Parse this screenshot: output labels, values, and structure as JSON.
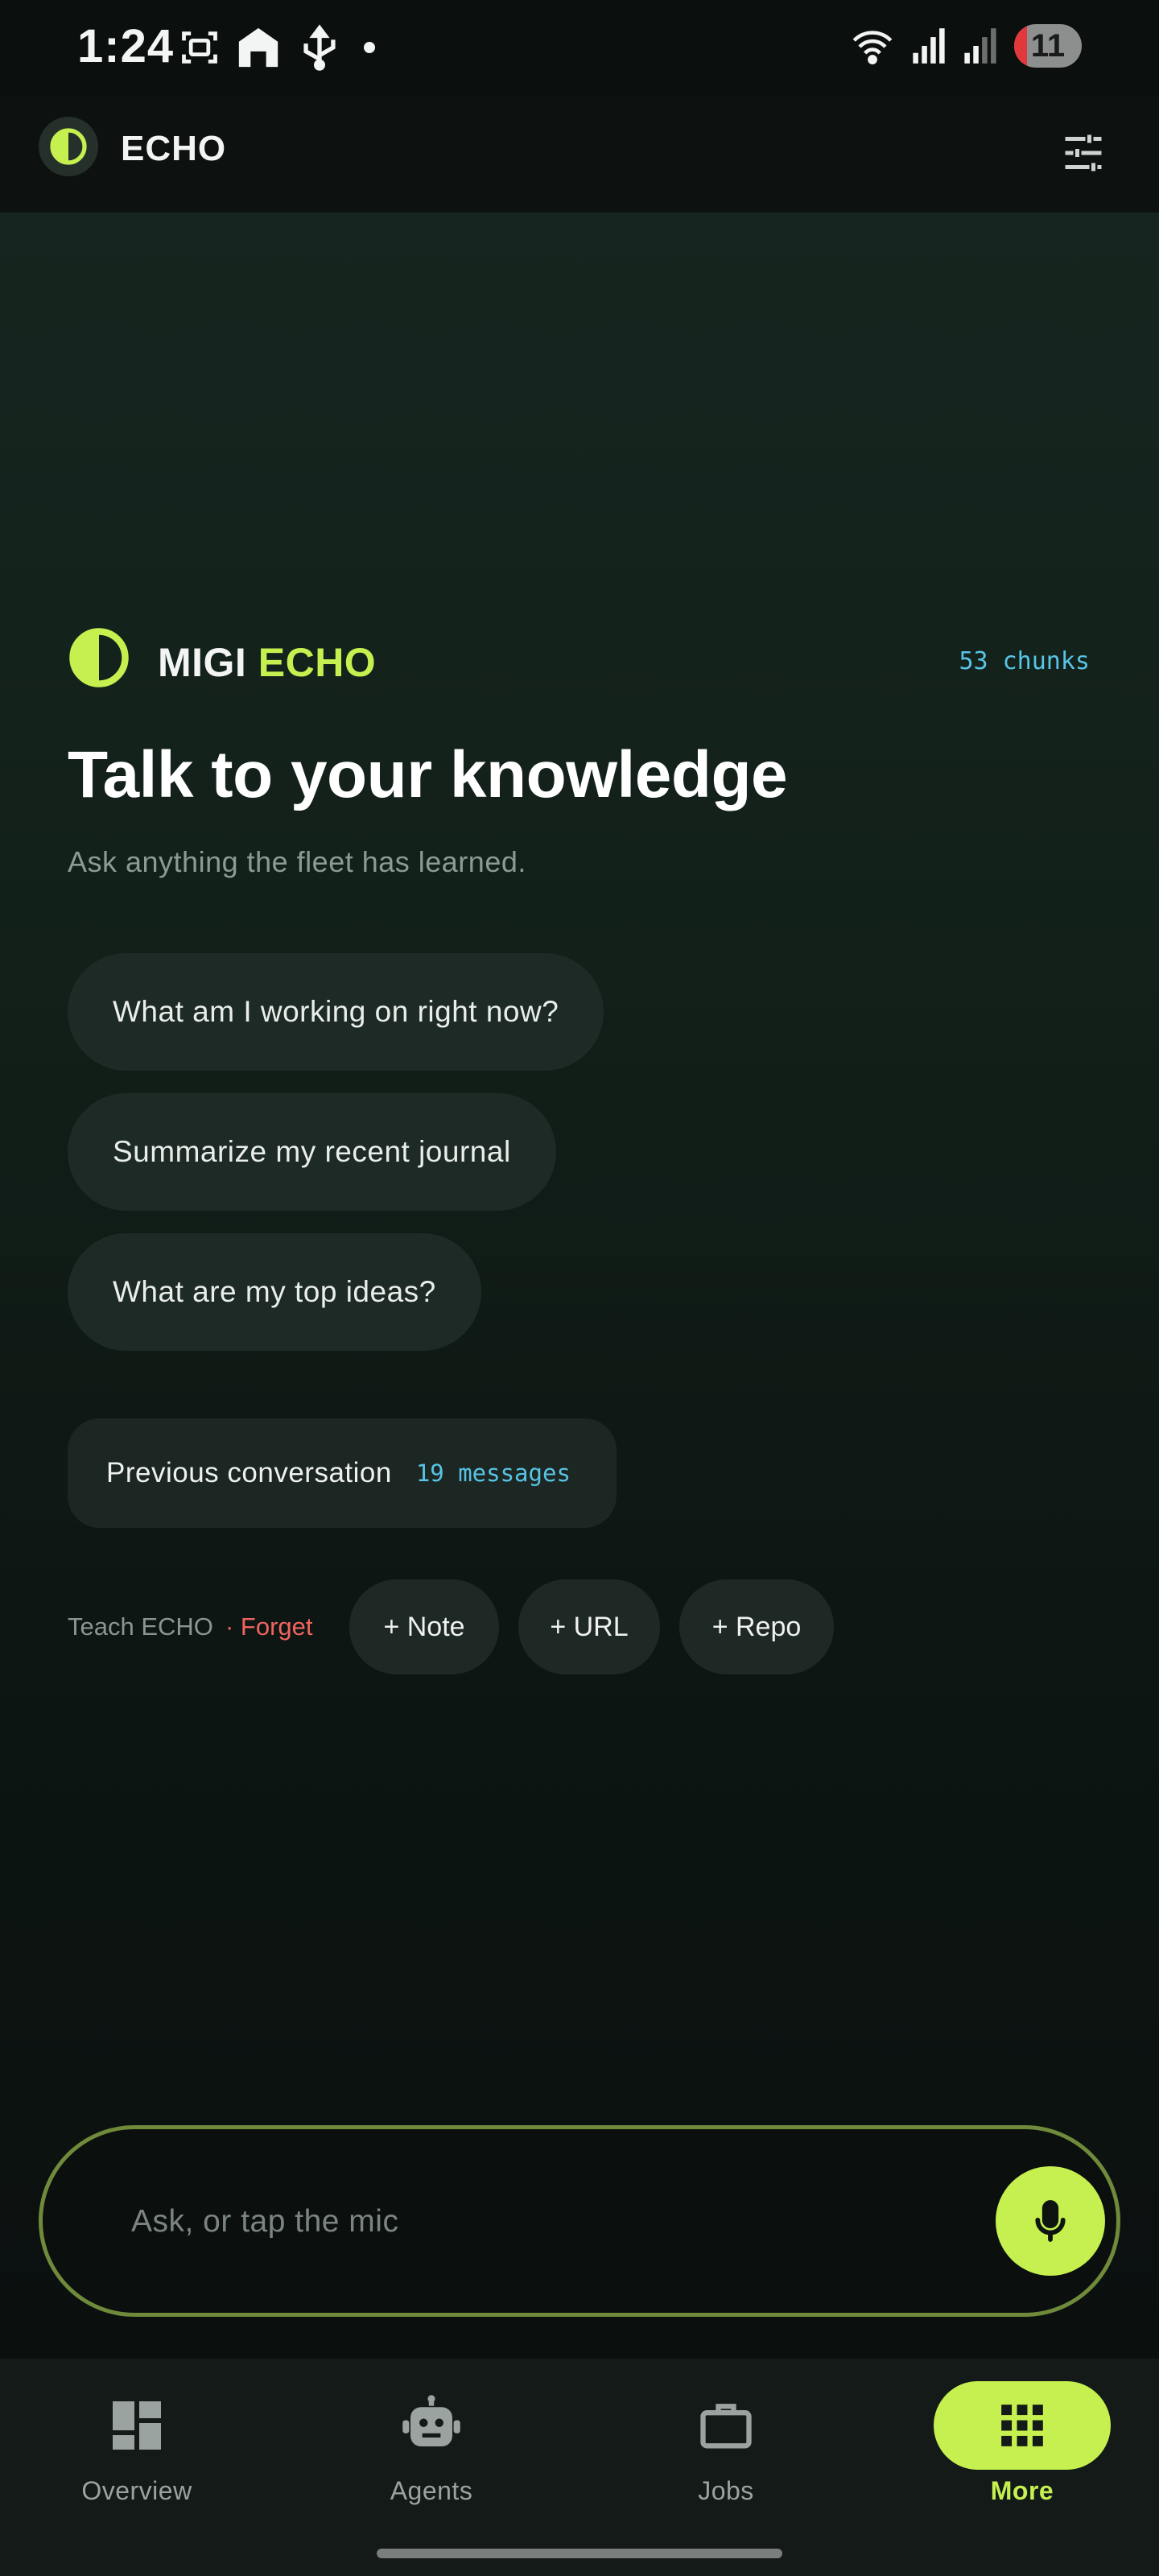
{
  "status_bar": {
    "time": "1:24",
    "battery": "11",
    "icons": [
      "screenshot-icon",
      "home-icon",
      "usb-icon",
      "dot-icon",
      "wifi-icon",
      "signal-icon",
      "signal-roaming-icon",
      "battery-icon"
    ]
  },
  "app_bar": {
    "title": "ECHO",
    "logo_icon": "half-circle-logo-icon",
    "settings_icon": "sliders-icon"
  },
  "hero": {
    "brand_prefix": "MIGI",
    "brand_accent": "ECHO",
    "chunks": "53 chunks",
    "headline": "Talk to your knowledge",
    "subhead": "Ask anything the fleet has learned."
  },
  "suggestions": [
    "What am I working on right now?",
    "Summarize my recent journal",
    "What are my top ideas?"
  ],
  "previous_conversation": {
    "label": "Previous conversation",
    "count": "19 messages"
  },
  "teach": {
    "label": "Teach ECHO",
    "forget": "· Forget",
    "chips": [
      "+ Note",
      "+ URL",
      "+ Repo"
    ]
  },
  "input": {
    "placeholder": "Ask, or tap the mic",
    "mic_icon": "mic-icon"
  },
  "nav": {
    "items": [
      {
        "label": "Overview",
        "icon": "dashboard-icon",
        "active": false
      },
      {
        "label": "Agents",
        "icon": "robot-icon",
        "active": false
      },
      {
        "label": "Jobs",
        "icon": "briefcase-icon",
        "active": false
      },
      {
        "label": "More",
        "icon": "grid-icon",
        "active": true
      }
    ]
  },
  "colors": {
    "accent": "#c5f04f",
    "mono_accent": "#58c4e6",
    "forget": "#f0645f"
  }
}
